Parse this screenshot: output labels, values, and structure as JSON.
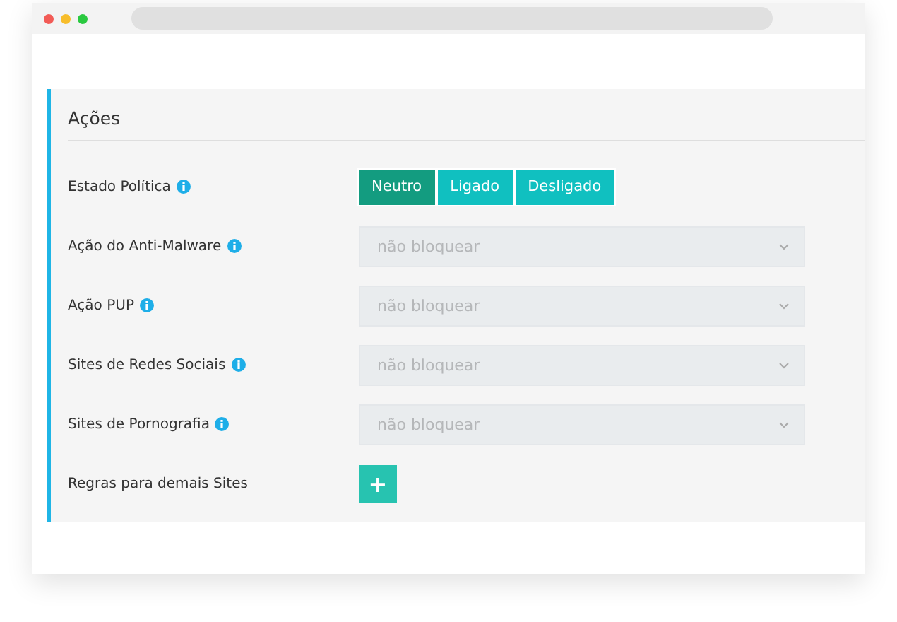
{
  "section": {
    "title": "Ações"
  },
  "rows": [
    {
      "kind": "toggle",
      "label": "Estado Política",
      "info": true,
      "options": [
        {
          "label": "Neutro",
          "selected": true
        },
        {
          "label": "Ligado",
          "selected": false
        },
        {
          "label": "Desligado",
          "selected": false
        }
      ]
    },
    {
      "kind": "select",
      "label": "Ação do Anti-Malware",
      "info": true,
      "value": "não bloquear",
      "disabled": true
    },
    {
      "kind": "select",
      "label": "Ação PUP",
      "info": true,
      "value": "não bloquear",
      "disabled": true
    },
    {
      "kind": "select",
      "label": "Sites de Redes Sociais",
      "info": true,
      "value": "não bloquear",
      "disabled": true
    },
    {
      "kind": "select",
      "label": "Sites de Pornografia",
      "info": true,
      "value": "não bloquear",
      "disabled": true
    },
    {
      "kind": "add",
      "label": "Regras para demais Sites",
      "info": false,
      "button": "+"
    }
  ]
}
